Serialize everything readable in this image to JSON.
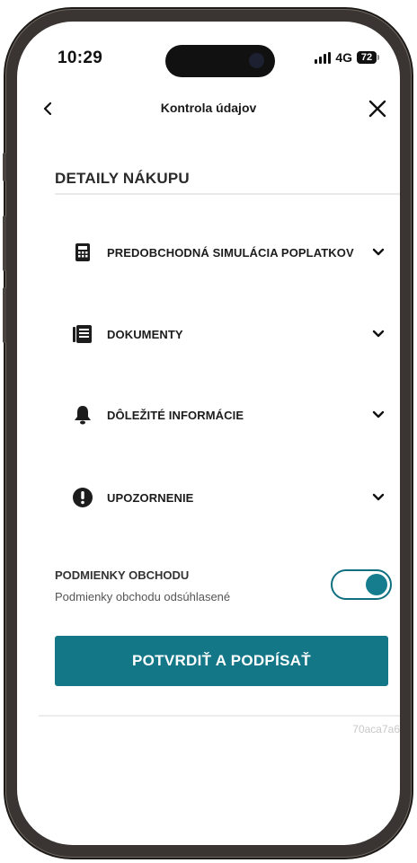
{
  "status_bar": {
    "time": "10:29",
    "network": "4G",
    "battery": "72"
  },
  "header": {
    "title": "Kontrola údajov",
    "back_icon": "chevron-left-icon",
    "close_icon": "close-icon"
  },
  "section": {
    "title": "DETAILY NÁKUPU"
  },
  "accordion": [
    {
      "label": "PREDOBCHODNÁ SIMULÁCIA POPLATKOV",
      "icon": "calculator-icon"
    },
    {
      "label": "DOKUMENTY",
      "icon": "document-icon"
    },
    {
      "label": "DÔLEŽITÉ INFORMÁCIE",
      "icon": "bell-icon"
    },
    {
      "label": "UPOZORNENIE",
      "icon": "warning-icon"
    }
  ],
  "terms": {
    "title": "PODMIENKY OBCHODU",
    "subtitle": "Podmienky obchodu odsúhlasené",
    "toggle_on": true
  },
  "actions": {
    "confirm_label": "POTVRDIŤ A PODPÍSAŤ"
  },
  "footer": {
    "build_id": "70aca7a6"
  },
  "colors": {
    "accent": "#147788",
    "toggle_border": "#0f6f7f",
    "text_dark": "#1c1c1c"
  }
}
